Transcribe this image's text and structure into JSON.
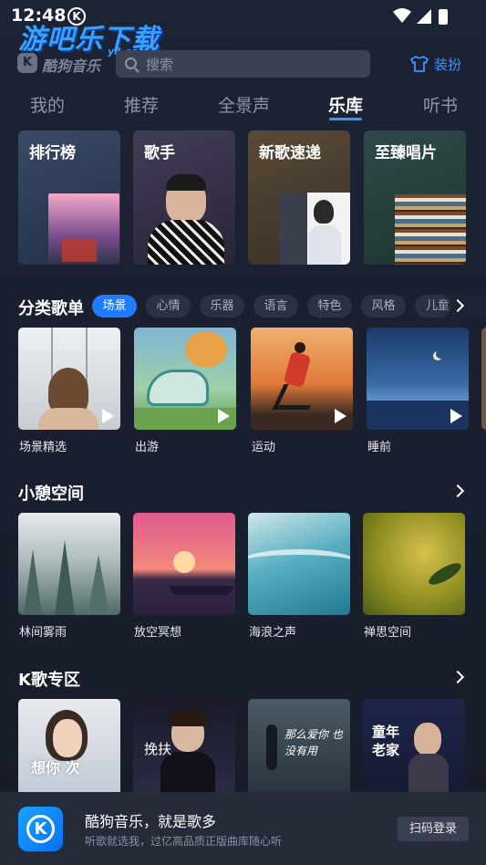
{
  "status_bar": {
    "time": "12:48",
    "k_badge": "K"
  },
  "watermark": {
    "title": "游吧乐下载",
    "domain": "y8.com"
  },
  "header": {
    "logo_letter": "K",
    "logo_text": "酷狗音乐",
    "search_placeholder": "搜索",
    "skin_label": "装扮"
  },
  "tabs": [
    {
      "label": "我的",
      "active": false
    },
    {
      "label": "推荐",
      "active": false
    },
    {
      "label": "全景声",
      "active": false
    },
    {
      "label": "乐库",
      "active": true
    },
    {
      "label": "听书",
      "active": false
    }
  ],
  "feature_cards": [
    {
      "label": "排行榜"
    },
    {
      "label": "歌手"
    },
    {
      "label": "新歌速递"
    },
    {
      "label": "至臻唱片"
    }
  ],
  "category_section": {
    "title": "分类歌单",
    "chips": [
      {
        "label": "场景",
        "active": true
      },
      {
        "label": "心情",
        "active": false
      },
      {
        "label": "乐器",
        "active": false
      },
      {
        "label": "语言",
        "active": false
      },
      {
        "label": "特色",
        "active": false
      },
      {
        "label": "风格",
        "active": false
      },
      {
        "label": "儿童",
        "active": false
      }
    ],
    "items": [
      {
        "caption": "场景精选"
      },
      {
        "caption": "出游"
      },
      {
        "caption": "运动"
      },
      {
        "caption": "睡前"
      }
    ]
  },
  "relax_section": {
    "title": "小憩空间",
    "items": [
      {
        "caption": "林间雾雨"
      },
      {
        "caption": "放空冥想"
      },
      {
        "caption": "海浪之声"
      },
      {
        "caption": "禅思空间"
      }
    ]
  },
  "ktv_section": {
    "title": "K歌专区",
    "items": [
      {
        "overlay": "想你 次"
      },
      {
        "overlay": "挽扶"
      },
      {
        "overlay": "那么爱你 也没有用"
      },
      {
        "overlay": "童年 老家"
      }
    ]
  },
  "banner": {
    "icon_letter": "K",
    "title": "酷狗音乐，就是歌多",
    "subtitle": "听歌就选我，过亿高品质正版曲库随心听",
    "login_label": "扫码登录"
  },
  "colors": {
    "accent": "#3b95ff",
    "chip_active": "#1f7cff",
    "background": "#1c2334"
  }
}
